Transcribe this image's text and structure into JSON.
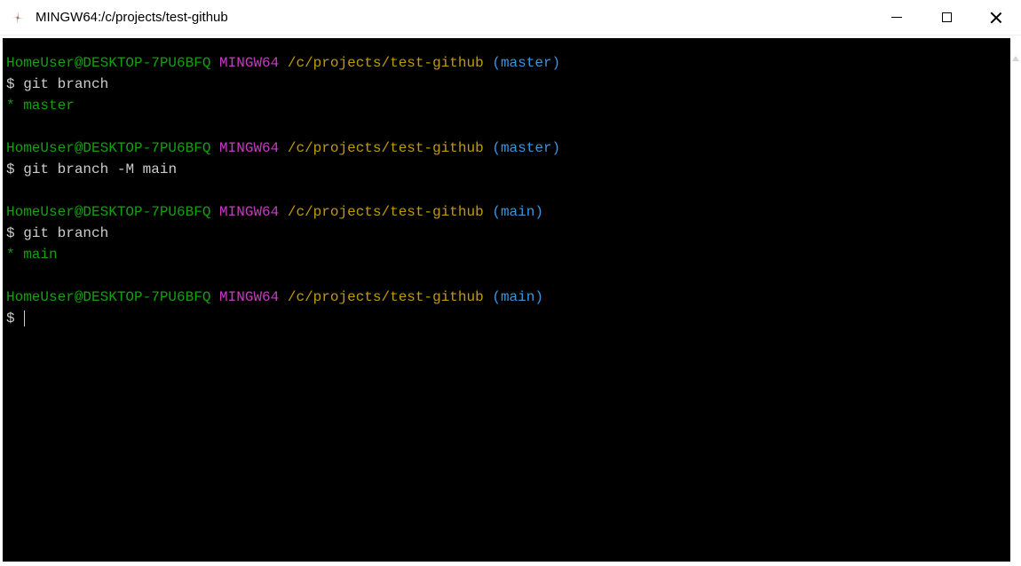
{
  "window": {
    "title": "MINGW64:/c/projects/test-github"
  },
  "prompt": {
    "user_host": "HomeUser@DESKTOP-7PU6BFQ",
    "shell": "MINGW64",
    "path": "/c/projects/test-github",
    "symbol": "$"
  },
  "blocks": [
    {
      "branch": "master",
      "command": "git branch",
      "output": "* master"
    },
    {
      "branch": "master",
      "command": "git branch -M main",
      "output": ""
    },
    {
      "branch": "main",
      "command": "git branch",
      "output": "* main"
    }
  ],
  "current": {
    "branch": "main",
    "command": ""
  }
}
